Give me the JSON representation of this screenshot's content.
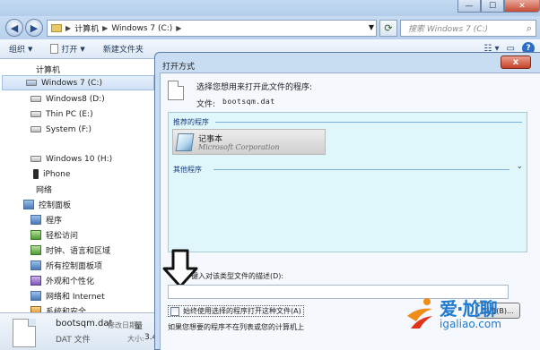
{
  "explorer": {
    "breadcrumb": [
      "计算机",
      "Windows 7 (C:)"
    ],
    "search_placeholder": "搜索 Windows 7 (C:)",
    "toolbar": {
      "organize": "组织",
      "open": "打开",
      "new_folder": "新建文件夹"
    },
    "nav_items": [
      {
        "label": "计算机",
        "icon": "computer-icon"
      },
      {
        "label": "Windows 7  (C:)",
        "icon": "windows-drive-icon",
        "selected": true
      },
      {
        "label": "Windows8 (D:)",
        "icon": "drive-icon"
      },
      {
        "label": "Thin PC (E:)",
        "icon": "drive-icon"
      },
      {
        "label": "System (F:)",
        "icon": "drive-icon"
      },
      {
        "label": "Windows 10 (H:)",
        "icon": "drive-icon"
      },
      {
        "label": "iPhone",
        "icon": "phone-icon"
      },
      {
        "label": "网络",
        "icon": "network-icon"
      },
      {
        "label": "控制面板",
        "icon": "control-panel-icon"
      },
      {
        "label": "程序",
        "icon": "programs-icon"
      },
      {
        "label": "轻松访问",
        "icon": "ease-of-access-icon"
      },
      {
        "label": "时钟、语言和区域",
        "icon": "clock-language-icon"
      },
      {
        "label": "所有控制面板项",
        "icon": "all-control-panel-icon"
      },
      {
        "label": "外观和个性化",
        "icon": "appearance-icon"
      },
      {
        "label": "网络和 Internet",
        "icon": "network-internet-icon"
      },
      {
        "label": "系统和安全",
        "icon": "system-security-icon"
      }
    ],
    "details": {
      "file_name": "bootsqm.dat",
      "file_type": "DAT 文件",
      "modified_label": "修改日期:",
      "modified_value": "量",
      "size_label": "大小:",
      "size_value": "3.4"
    }
  },
  "dialog": {
    "title": "打开方式",
    "close_label": "x",
    "instruction": "选择您想用来打开此文件的程序:",
    "file_label": "文件:",
    "file_name": "bootsqm.dat",
    "recommended_header": "推荐的程序",
    "programs": [
      {
        "name": "记事本",
        "company": "Microsoft Corporation"
      }
    ],
    "other_header": "其他程序",
    "describe_label": "键入对该类型文件的描述(D):",
    "always_use_label": "始终使用选择的程序打开这种文件(A)",
    "browse_label": "浏览(B)...",
    "hint": "如果您想要的程序不在列表或您的计算机上"
  },
  "watermark": {
    "title": "爱·尬聊",
    "domain": "igaliao.com"
  },
  "colors": {
    "dialog_frame": "#c8dcf2",
    "program_list_bg": "#dff7fb",
    "close_button": "#c64028",
    "watermark": "#1f7ad0"
  }
}
